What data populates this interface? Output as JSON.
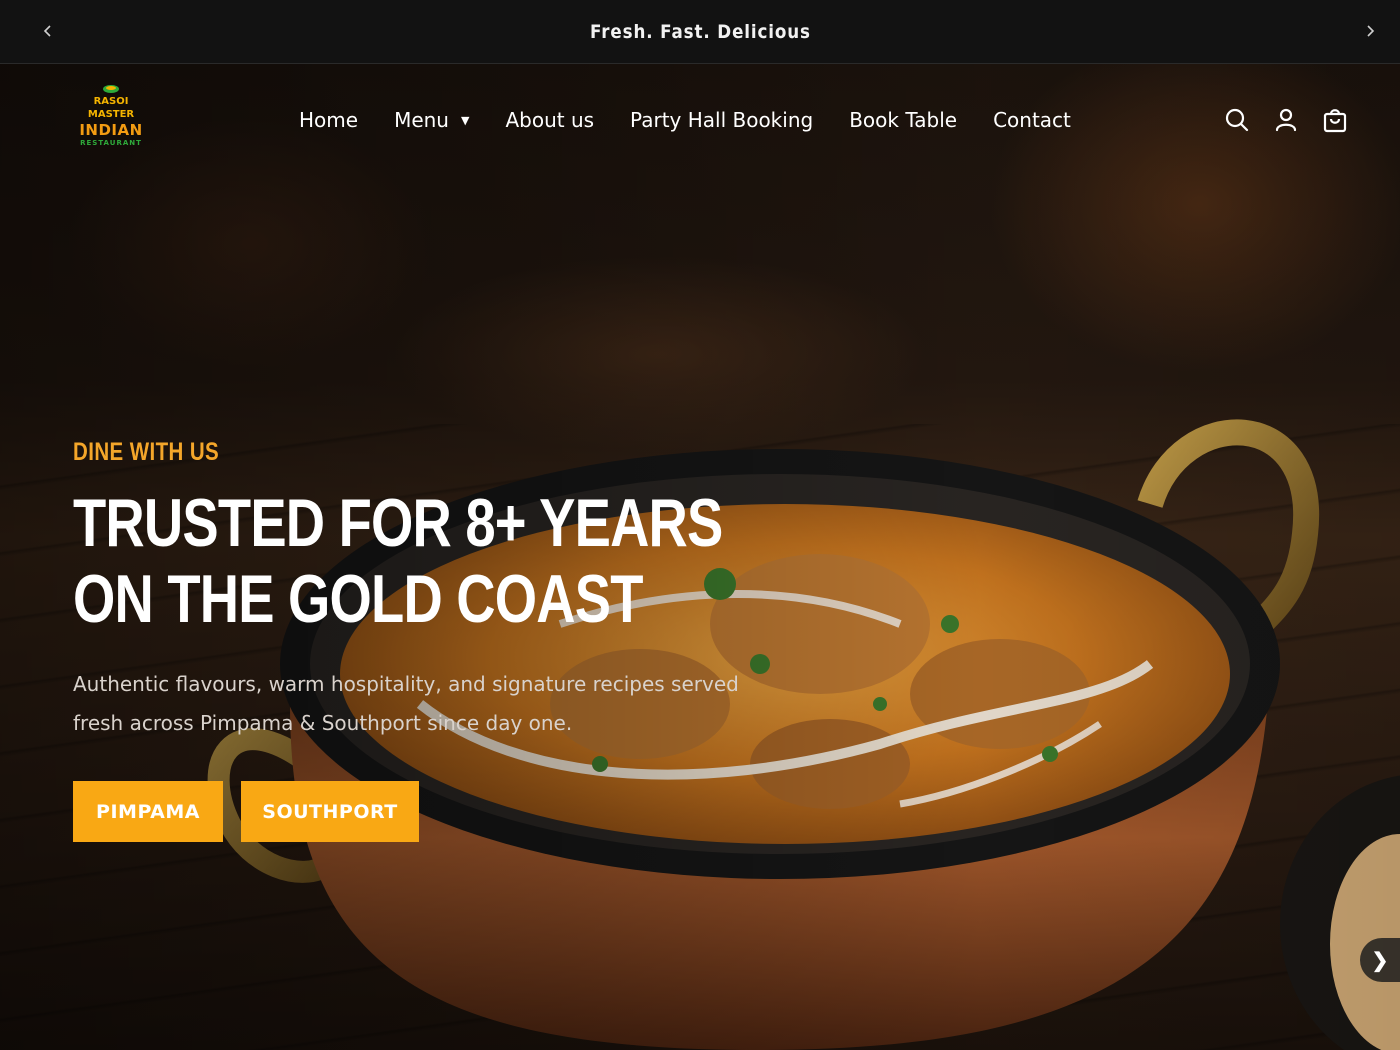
{
  "announcement": {
    "text": "Fresh. Fast. Delicious",
    "prev_icon": "chevron-left-icon",
    "next_icon": "chevron-right-icon"
  },
  "logo": {
    "line1": "RASOI",
    "line2": "MASTER",
    "line3": "INDIAN",
    "line4": "RESTAURANT"
  },
  "nav": {
    "items": [
      {
        "label": "Home"
      },
      {
        "label": "Menu",
        "has_dropdown": true
      },
      {
        "label": "About us"
      },
      {
        "label": "Party Hall Booking"
      },
      {
        "label": "Book Table"
      },
      {
        "label": "Contact"
      }
    ],
    "dropdown_caret": "▼"
  },
  "header_icons": [
    "search-icon",
    "account-icon",
    "cart-icon"
  ],
  "hero": {
    "eyebrow": "DINE WITH US",
    "title_line1": "TRUSTED FOR 8+ YEARS",
    "title_line2": "ON THE GOLD COAST",
    "lead_line1": "Authentic flavours, warm hospitality, and signature recipes served",
    "lead_line2": "fresh across Pimpama & Southport since day one.",
    "buttons": [
      {
        "label": "PIMPAMA"
      },
      {
        "label": "SOUTHPORT"
      }
    ],
    "next_arrow": "❯"
  },
  "colors": {
    "accent": "#f9a814",
    "eyebrow": "#f4a62a",
    "topbar": "#121212"
  }
}
